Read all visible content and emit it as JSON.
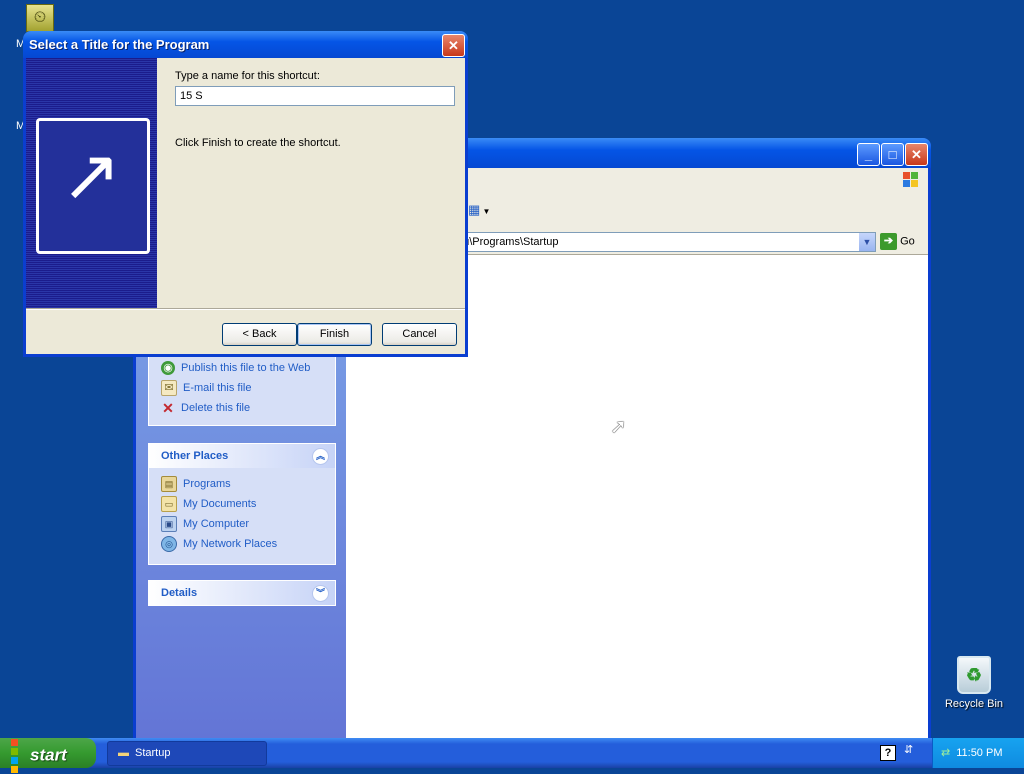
{
  "desktop": {
    "recycle_bin_label": "Recycle Bin",
    "truncated_label_1": "M",
    "truncated_label_2": "M"
  },
  "explorer": {
    "address_value": "nu\\Programs\\Startup",
    "go_label": "Go",
    "file_tasks": [
      {
        "label": "Publish this file to the Web",
        "icon": "globe-icon"
      },
      {
        "label": "E-mail this file",
        "icon": "email-icon"
      },
      {
        "label": "Delete this file",
        "icon": "delete-icon"
      }
    ],
    "other_places": {
      "title": "Other Places",
      "items": [
        {
          "label": "Programs",
          "icon": "programs-folder-icon"
        },
        {
          "label": "My Documents",
          "icon": "my-documents-icon"
        },
        {
          "label": "My Computer",
          "icon": "my-computer-icon"
        },
        {
          "label": "My Network Places",
          "icon": "network-places-icon"
        }
      ]
    },
    "details": {
      "title": "Details"
    }
  },
  "wizard": {
    "title": "Select a Title for the Program",
    "prompt_label": "Type a name for this shortcut:",
    "name_value": "15 S",
    "instruction": "Click Finish to create the shortcut.",
    "back_label": "< Back",
    "finish_label": "Finish",
    "cancel_label": "Cancel"
  },
  "taskbar": {
    "start_label": "start",
    "task_button_label": "Startup",
    "clock": "11:50 PM"
  },
  "colors": {
    "desktop": "#0a4596",
    "xp_title_blue": "#0555e6",
    "link_blue": "#215dc6",
    "start_green": "#359a2f"
  }
}
